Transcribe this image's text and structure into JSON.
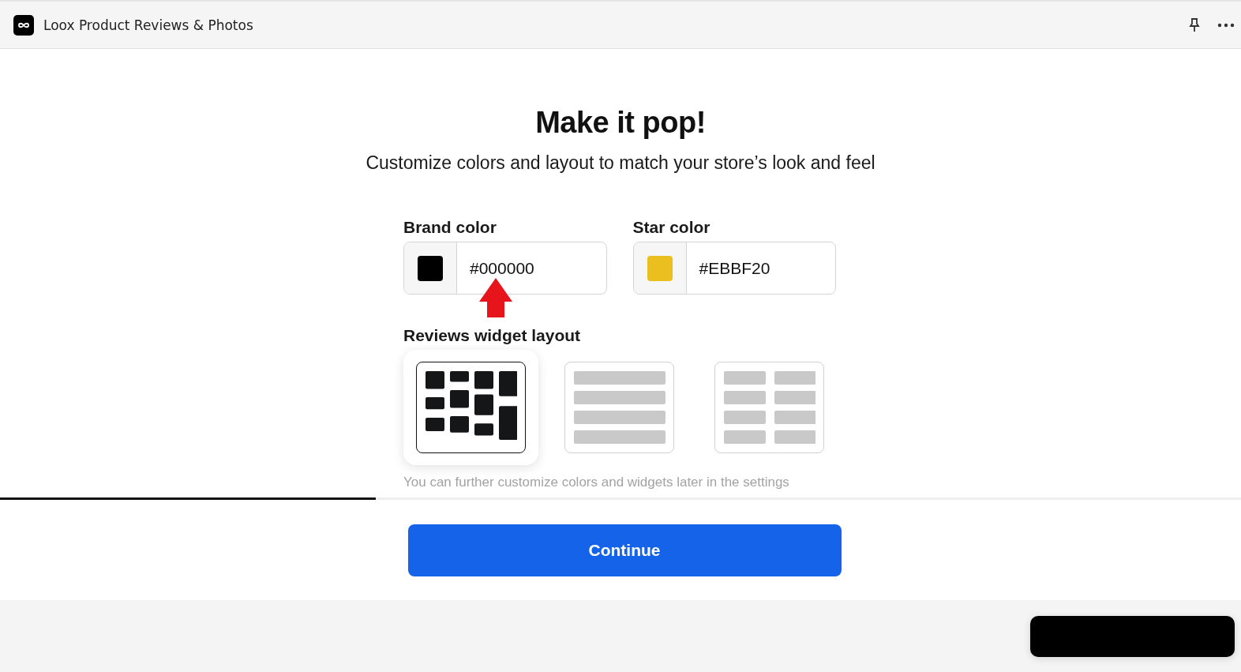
{
  "window": {
    "title": "Loox Product Reviews & Photos"
  },
  "heading": "Make it pop!",
  "subtitle": "Customize colors and layout to match your store’s look and feel",
  "color_fields": [
    {
      "label": "Brand color",
      "value": "#000000",
      "color": "#000000"
    },
    {
      "label": "Star color",
      "value": "#EBBF20",
      "color": "#ebbf20"
    }
  ],
  "layout_label": "Reviews widget layout",
  "layouts": [
    {
      "kind": "masonry",
      "selected": true
    },
    {
      "kind": "list",
      "selected": false
    },
    {
      "kind": "grid",
      "selected": false
    }
  ],
  "note": "You can further customize colors and widgets later in the settings",
  "progress": {
    "level": 0.303
  },
  "continue_button": "Continue"
}
